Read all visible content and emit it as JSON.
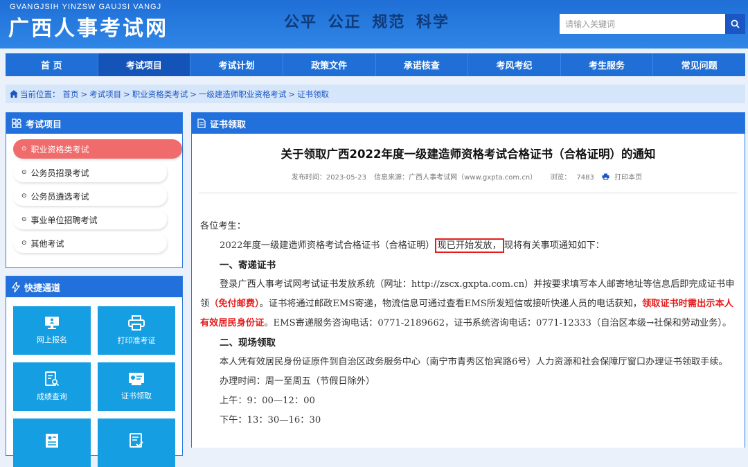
{
  "header": {
    "logo_en": "GVANGJSIH YINZSW GAUJSI VANGJ",
    "logo_cn": "广西人事考试网",
    "slogan": "公平  公正  规范  科学",
    "search_placeholder": "请输入关键词",
    "search_icon": "search-icon"
  },
  "nav": {
    "items": [
      "首 页",
      "考试项目",
      "考试计划",
      "政策文件",
      "承诺核查",
      "考风考纪",
      "考生服务",
      "常见问题"
    ],
    "active_index": 1
  },
  "breadcrumb": {
    "prefix": "当前位置：",
    "items": [
      "首页",
      "考试项目",
      "职业资格类考试",
      "一级建造师职业资格考试",
      "证书领取"
    ]
  },
  "sidebar": {
    "categories_title": "考试项目",
    "categories": [
      "职业资格类考试",
      "公务员招录考试",
      "公务员遴选考试",
      "事业单位招聘考试",
      "其他考试"
    ],
    "active_category": 0,
    "quick_title": "快捷通道",
    "quick_links": [
      {
        "label": "网上报名",
        "icon": "monitor-icon"
      },
      {
        "label": "打印准考证",
        "icon": "printer-icon"
      },
      {
        "label": "成绩查询",
        "icon": "search-document-icon"
      },
      {
        "label": "证书领取",
        "icon": "certificate-icon"
      },
      {
        "label": "",
        "icon": "profile-card-icon"
      },
      {
        "label": "",
        "icon": "checklist-icon"
      }
    ]
  },
  "article": {
    "section_title": "证书领取",
    "title": "关于领取广西2022年度一级建造师资格考试合格证书（合格证明）的通知",
    "meta": {
      "publish": "发布时间：2023-05-23",
      "source": "信息来源：广西人事考试网（www.gxpta.com.cn）",
      "views_label": "浏览：",
      "views": "7483",
      "print": "打印本页"
    },
    "greeting": "各位考生：",
    "intro_a": "2022年度一级建造师资格考试合格证书（合格证明）",
    "intro_highlight": "现已开始发放，",
    "intro_b": "现将有关事项通知如下：",
    "sec1": "一、寄递证书",
    "sec1_a": "登录广西人事考试网考试证书发放系统（网址：http://zscx.gxpta.com.cn）并按要求填写本人邮寄地址等信息后即完成证书申领",
    "sec1_red1": "（免付邮费）",
    "sec1_b": "。证书将通过邮政EMS寄递，物流信息可通过查看EMS所发短信或接听快递人员的电话获知，",
    "sec1_red2": "领取证书时需出示本人有效居民身份证",
    "sec1_c": "。EMS寄递服务咨询电话：0771-2189662，证书系统咨询电话：0771-12333（自治区本级→社保和劳动业务）。",
    "sec2": "二、现场领取",
    "sec2_a": "本人凭有效居民身份证原件到自治区政务服务中心（南宁市青秀区怡宾路6号）人力资源和社会保障厅窗口办理证书领取手续。",
    "hours": "办理时间：周一至周五（节假日除外）",
    "am": "上午：9：00—12：00",
    "pm": "下午：13：30—16：30"
  }
}
